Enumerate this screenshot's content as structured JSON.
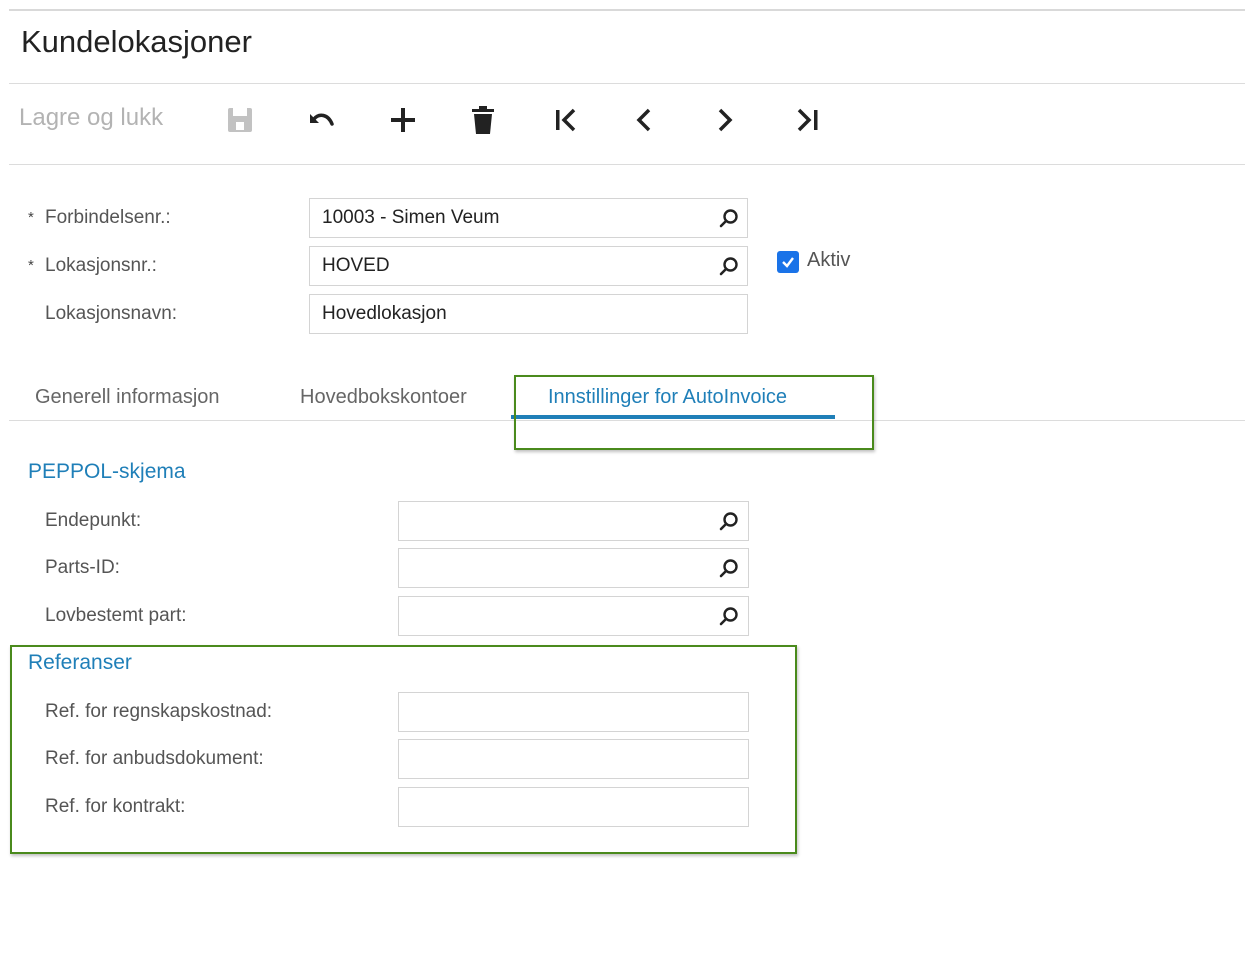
{
  "page": {
    "title": "Kundelokasjoner"
  },
  "toolbar": {
    "save_close_label": "Lagre og lukk",
    "icons": [
      "save-icon",
      "undo-icon",
      "add-icon",
      "delete-icon",
      "first-record-icon",
      "previous-record-icon",
      "next-record-icon",
      "last-record-icon"
    ]
  },
  "header": {
    "required_marker": "*",
    "customer": {
      "label": "Forbindelsenr.:",
      "value": "10003 - Simen Veum"
    },
    "location": {
      "label": "Lokasjonsnr.:",
      "value": "HOVED"
    },
    "location_name": {
      "label": "Lokasjonsnavn:",
      "value": "Hovedlokasjon"
    },
    "active": {
      "label": "Aktiv",
      "checked": true
    }
  },
  "tabs": [
    {
      "label": "Generell informasjon",
      "active": false
    },
    {
      "label": "Hovedbokskontoer",
      "active": false
    },
    {
      "label": "Innstillinger for AutoInvoice",
      "active": true
    }
  ],
  "peppol": {
    "title": "PEPPOL-skjema",
    "endpoint": {
      "label": "Endepunkt:",
      "value": ""
    },
    "party_id": {
      "label": "Parts-ID:",
      "value": ""
    },
    "legal_party": {
      "label": "Lovbestemt part:",
      "value": ""
    }
  },
  "references": {
    "title": "Referanser",
    "accounting_cost": {
      "label": "Ref. for regnskapskostnad:",
      "value": ""
    },
    "tender_document": {
      "label": "Ref. for anbudsdokument:",
      "value": ""
    },
    "contract": {
      "label": "Ref. for kontrakt:",
      "value": ""
    }
  },
  "colors": {
    "accent": "#1f7fb8",
    "highlight": "#4a8a1c",
    "checkbox": "#1a73e8"
  }
}
